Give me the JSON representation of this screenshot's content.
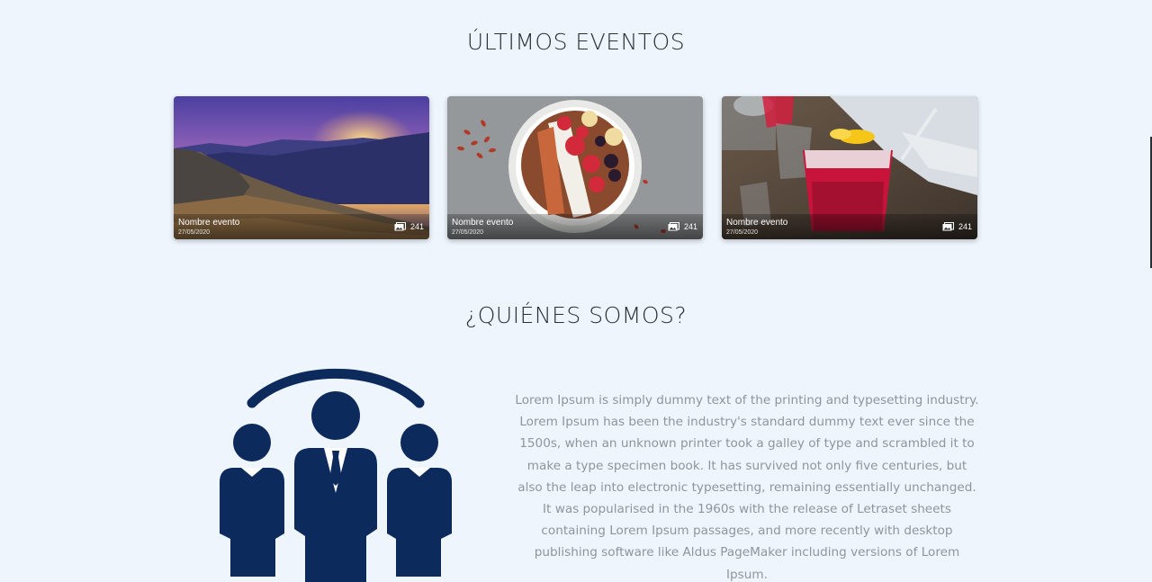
{
  "events": {
    "title": "ÚLTIMOS EVENTOS",
    "cards": [
      {
        "name": "Nombre evento",
        "date": "27/05/2020",
        "count": "241",
        "image": "mountain-sunset"
      },
      {
        "name": "Nombre evento",
        "date": "27/05/2020",
        "count": "241",
        "image": "fruit-bowl"
      },
      {
        "name": "Nombre evento",
        "date": "27/05/2020",
        "count": "241",
        "image": "red-cocktail"
      }
    ],
    "count_icon": "images-icon"
  },
  "about": {
    "title": "¿QUIÉNES SOMOS?",
    "illustration": "team-people-icon",
    "illustration_color": "#0c2a5c",
    "text": "Lorem Ipsum is simply dummy text of the printing and typesetting industry. Lorem Ipsum has been the industry's standard dummy text ever since the 1500s, when an unknown printer took a galley of type and scrambled it to make a type specimen book. It has survived not only five centuries, but also the leap into electronic typesetting, remaining essentially unchanged. It was popularised in the 1960s with the release of Letraset sheets containing Lorem Ipsum passages, and more recently with desktop publishing software like Aldus PageMaker including versions of Lorem Ipsum."
  },
  "colors": {
    "background": "#eef5fd",
    "heading": "#2b2f36",
    "body_text": "#8f959c"
  }
}
